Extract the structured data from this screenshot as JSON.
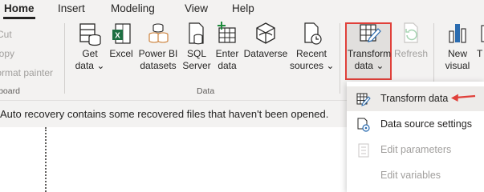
{
  "tabs": [
    "Home",
    "Insert",
    "Modeling",
    "View",
    "Help"
  ],
  "clipboard": {
    "items": [
      "Cut",
      "Copy",
      "Format painter"
    ],
    "group_label": "Clipboard"
  },
  "data_group": {
    "label": "Data",
    "buttons": [
      {
        "line1": "Get",
        "line2": "data",
        "has_dropdown": true,
        "icon": "database-icon"
      },
      {
        "line1": "Excel",
        "line2": "",
        "has_dropdown": false,
        "icon": "excel-icon"
      },
      {
        "line1": "Power BI",
        "line2": "datasets",
        "has_dropdown": false,
        "icon": "datasets-icon"
      },
      {
        "line1": "SQL",
        "line2": "Server",
        "has_dropdown": false,
        "icon": "sql-server-icon"
      },
      {
        "line1": "Enter",
        "line2": "data",
        "has_dropdown": false,
        "icon": "table-add-icon"
      },
      {
        "line1": "Dataverse",
        "line2": "",
        "has_dropdown": false,
        "icon": "dataverse-icon"
      },
      {
        "line1": "Recent",
        "line2": "sources",
        "has_dropdown": true,
        "icon": "recent-sources-icon"
      }
    ]
  },
  "queries_group": {
    "transform": {
      "line1": "Transform",
      "line2": "data",
      "has_dropdown": true
    },
    "refresh": {
      "line1": "Refresh",
      "disabled": true
    }
  },
  "insert_group": {
    "new_visual": {
      "line1": "New",
      "line2": "visual"
    },
    "next_partial": "T"
  },
  "notification": {
    "text": "Auto recovery contains some recovered files that haven't been opened."
  },
  "dropdown": {
    "items": [
      {
        "label": "Transform data",
        "disabled": false,
        "icon": "transform-data-icon"
      },
      {
        "label": "Data source settings",
        "disabled": false,
        "icon": "data-source-settings-icon"
      },
      {
        "label": "Edit parameters",
        "disabled": true,
        "icon": "edit-parameters-icon"
      },
      {
        "label": "Edit variables",
        "disabled": true,
        "icon": ""
      }
    ]
  },
  "colors": {
    "annotation": "#e0403a",
    "ribbon_bg": "#f3f2f1",
    "disabled_text": "#a19f9d",
    "excel_green": "#1d6f42"
  }
}
